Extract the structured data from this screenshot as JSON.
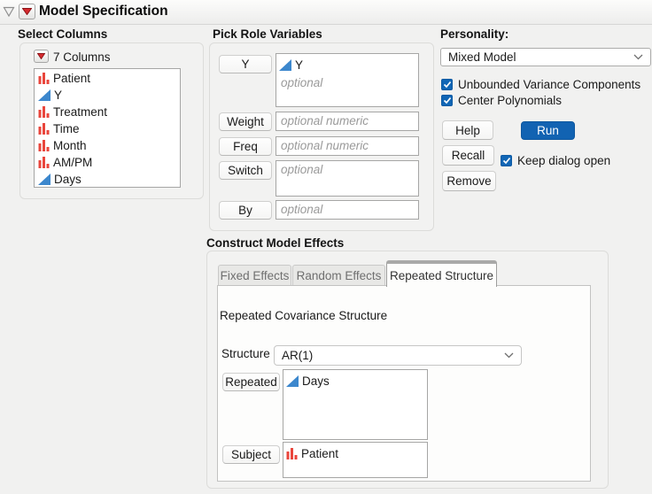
{
  "window": {
    "title": "Model Specification"
  },
  "select_columns": {
    "heading": "Select Columns",
    "summary": "7 Columns",
    "items": [
      {
        "label": "Patient",
        "type": "nominal"
      },
      {
        "label": "Y",
        "type": "continuous"
      },
      {
        "label": "Treatment",
        "type": "nominal"
      },
      {
        "label": "Time",
        "type": "nominal"
      },
      {
        "label": "Month",
        "type": "nominal"
      },
      {
        "label": "AM/PM",
        "type": "nominal"
      },
      {
        "label": "Days",
        "type": "continuous"
      }
    ]
  },
  "pick_roles": {
    "heading": "Pick Role Variables",
    "y": {
      "button": "Y",
      "item": "Y",
      "item_type": "continuous",
      "placeholder": "optional"
    },
    "weight": {
      "button": "Weight",
      "placeholder": "optional numeric"
    },
    "freq": {
      "button": "Freq",
      "placeholder": "optional numeric"
    },
    "switch": {
      "button": "Switch",
      "placeholder": "optional"
    },
    "by": {
      "button": "By",
      "placeholder": "optional"
    }
  },
  "personality": {
    "label": "Personality:",
    "value": "Mixed Model",
    "checkbox_unbounded": {
      "label": "Unbounded Variance Components",
      "checked": true
    },
    "checkbox_center": {
      "label": "Center Polynomials",
      "checked": true
    },
    "help_label": "Help",
    "run_label": "Run",
    "recall_label": "Recall",
    "remove_label": "Remove",
    "keep_dialog": {
      "label": "Keep dialog open",
      "checked": true
    }
  },
  "construct": {
    "heading": "Construct Model Effects",
    "tabs": [
      {
        "label": "Fixed Effects",
        "active": false
      },
      {
        "label": "Random Effects",
        "active": false
      },
      {
        "label": "Repeated Structure",
        "active": true
      }
    ],
    "subtitle": "Repeated Covariance Structure",
    "structure_label": "Structure",
    "structure_value": "AR(1)",
    "repeated_button": "Repeated",
    "repeated_item": {
      "label": "Days",
      "type": "continuous"
    },
    "subject_button": "Subject",
    "subject_item": {
      "label": "Patient",
      "type": "nominal"
    }
  },
  "colors": {
    "accent_blue": "#1263b2",
    "checkbox_blue": "#1166b5",
    "continuous_blue": "#3c87cd",
    "nominal_red": "#e9463c",
    "red_triangle": "#d62b2f"
  }
}
